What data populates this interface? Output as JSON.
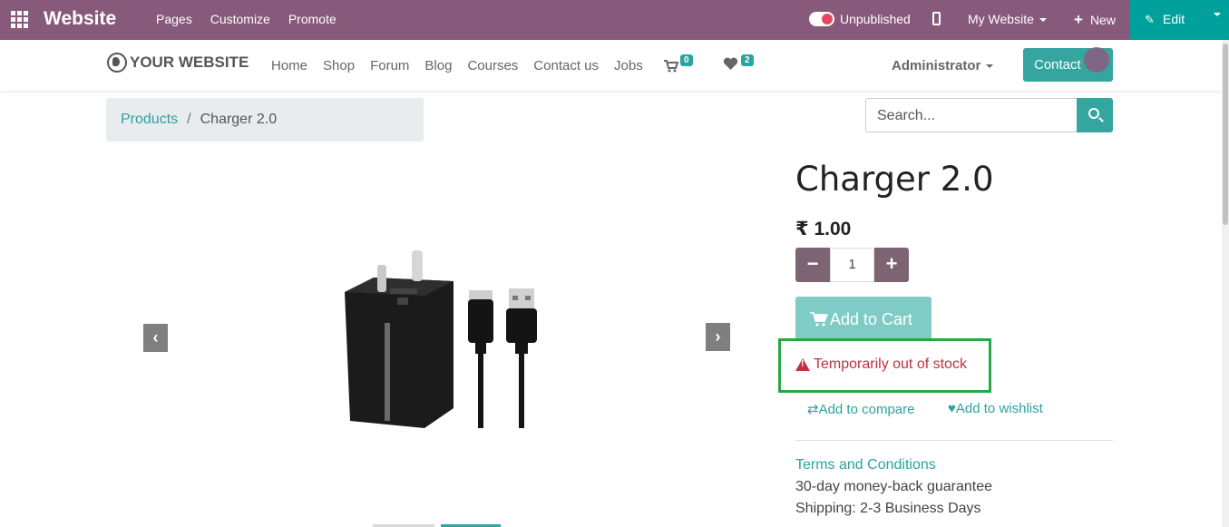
{
  "admin_bar": {
    "app_title": "Website",
    "menu": [
      "Pages",
      "Customize",
      "Promote"
    ],
    "publish_label": "Unpublished",
    "website_selector": "My Website",
    "new_label": "New",
    "edit_label": "Edit"
  },
  "site_nav": {
    "logo_text": "YOUR WEBSITE",
    "links": [
      "Home",
      "Shop",
      "Forum",
      "Blog",
      "Courses",
      "Contact us",
      "Jobs"
    ],
    "cart_count": "0",
    "wishlist_count": "2",
    "user": "Administrator",
    "contact_label": "Contact"
  },
  "breadcrumb": {
    "parent": "Products",
    "separator": "/",
    "current": "Charger 2.0"
  },
  "search": {
    "placeholder": "Search..."
  },
  "product": {
    "name": "Charger 2.0",
    "price": "₹ 1.00",
    "quantity": "1",
    "add_to_cart": "Add to Cart",
    "stock_message": "Temporarily out of stock",
    "add_to_compare": "Add to compare",
    "add_to_wishlist": "Add to wishlist",
    "terms_link": "Terms and Conditions",
    "guarantee": "30-day money-back guarantee",
    "shipping": "Shipping: 2-3 Business Days"
  },
  "colors": {
    "admin_bar": "#875a7b",
    "edit": "#00a09d",
    "accent": "#35a59f",
    "stock_warning": "#c0303f",
    "highlight_border": "#28a745"
  }
}
